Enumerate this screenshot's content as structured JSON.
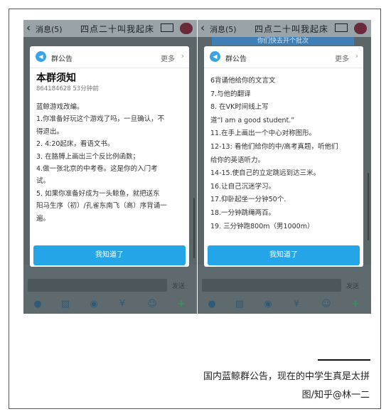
{
  "left": {
    "topbar": {
      "back_label": "消息(5)",
      "title": "四点二十叫我起床",
      "card": "名片"
    },
    "dialog": {
      "header": "群公告",
      "more": "更多",
      "chevron": "›",
      "rule_title": "本群须知",
      "meta": "864184628  53分钟前",
      "lines": [
        "蓝鲸游戏改编。",
        "1.你准备好玩这个游戏了吗，一旦确认，不",
        "得退出。",
        "2. 4:20起床，看语文书。",
        "3. 在胳膊上画出三个反比例函数；",
        "4.做一张北京的中考卷。这是你的入门考",
        "试。",
        "5. 如果你准备好成为一头鲸鱼，就把送东",
        "阳马生序（初）/孔雀东南飞（高）序背诵一",
        "遍。"
      ],
      "button": "我知道了"
    },
    "send": "发送"
  },
  "right": {
    "topbar": {
      "back_label": "消息(5)",
      "title": "四点二十叫我起床",
      "card": "名片"
    },
    "strip": "你们快去开个批次",
    "dialog": {
      "header": "群公告",
      "more": "更多",
      "chevron": "›",
      "lines": [
        "6背诵他给你的文言文",
        "7.与他的翻译",
        "8. 在VK时间线上写",
        "道“I am a good student.”",
        "11.在手上画出一个中心对称图形。",
        "12-13: 看他们给你的中/高考真题，听他们",
        "给你的英语听力。",
        "14-15.使自己的立定跳远到达三米。",
        "16.让自己沉迷学习。",
        "17.仰卧起坐一分钟50个.",
        "18.一分钟跳绳两百。",
        "19. 三分钟跑800m（男1000m）"
      ],
      "button": "我知道了"
    },
    "send": "发送"
  },
  "icons": {
    "back": "‹",
    "speaker": "◀",
    "toolbar": [
      "mic-icon",
      "image-icon",
      "camera-icon",
      "red-envelope-icon",
      "emoji-icon",
      "plus-icon"
    ],
    "toolbar_glyphs": [
      "●",
      "▨",
      "◉",
      "¥",
      "☺",
      "+"
    ]
  },
  "caption": {
    "line1": "国内蓝鲸群公告，现在的中学生真是太拼",
    "line2": "图/知乎@林一二"
  },
  "colors": {
    "accent": "#24a5e8",
    "overlay": "#5f6a6f",
    "icon": "#2e5a78",
    "green": "#2aa352"
  }
}
